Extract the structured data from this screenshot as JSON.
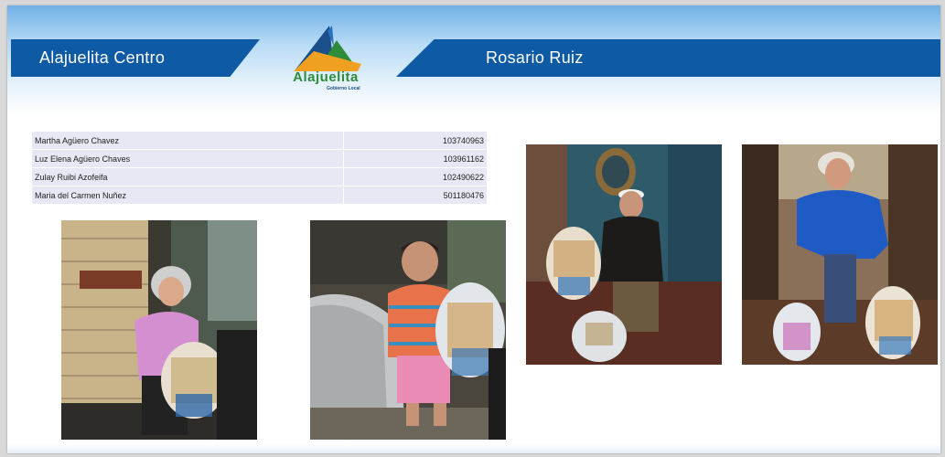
{
  "header": {
    "left_title": "Alajuelita Centro",
    "right_title": "Rosario Ruiz"
  },
  "logo": {
    "name": "Alajuelita",
    "subtitle": "Gobierno Local"
  },
  "beneficiaries": [
    {
      "name": "Martha Agüero Chavez",
      "id": "103740963"
    },
    {
      "name": "Luz Elena Agüero Chaves",
      "id": "103961162"
    },
    {
      "name": "Zulay Ruibi Azofeifa",
      "id": "102490622"
    },
    {
      "name": "Maria del Carmen Nuñez",
      "id": "501180476"
    }
  ],
  "colors": {
    "ribbon": "#0f5aa5",
    "logo_green": "#2e8b3a",
    "logo_blue": "#1b4f8a",
    "logo_orange": "#f0a020",
    "table_row": "#e6e9f3"
  }
}
